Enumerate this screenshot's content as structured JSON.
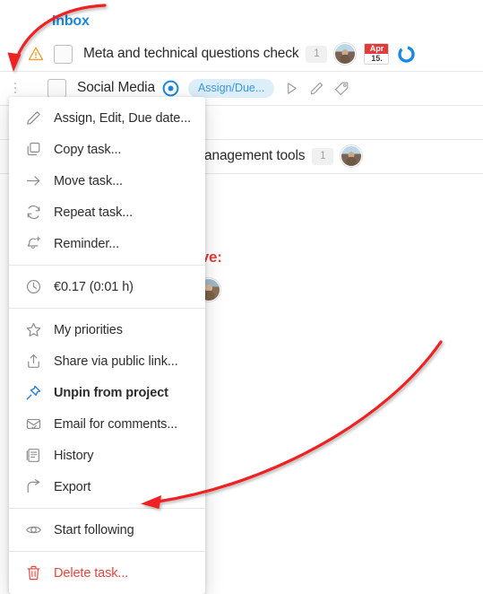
{
  "colors": {
    "accent_blue": "#1a87e0",
    "pill_bg": "#ddeefb",
    "pill_text": "#3a95df",
    "danger_red": "#e8453c",
    "heading_red": "#e23b3b",
    "warning_orange": "#f0a030",
    "annotation_red": "#ee2222",
    "pin_blue": "#2a7fd4"
  },
  "list": {
    "header": "Inbox",
    "rows": [
      {
        "name": "Meta and technical questions check",
        "warning_icon": "warning-triangle-icon",
        "count": "1",
        "avatar": "user-avatar",
        "date_month": "Apr",
        "date_day": "15.",
        "progress_ring": "progress-ring-icon"
      },
      {
        "name": "Social Media",
        "handle": "drag-handle-icon",
        "radio": "radio-dot-icon",
        "pill": "Assign/Due...",
        "icons": [
          "play-icon",
          "pencil-icon",
          "tag-icon"
        ]
      },
      {
        "name": "anagement tools",
        "count": "1",
        "avatar": "user-avatar"
      }
    ],
    "red_heading": "list have:"
  },
  "menu": {
    "groups": [
      {
        "items": [
          {
            "label": "Assign, Edit, Due date...",
            "icon": "pencil-icon",
            "style": "normal"
          },
          {
            "label": "Copy task...",
            "icon": "copy-icon",
            "style": "normal"
          },
          {
            "label": "Move task...",
            "icon": "arrow-right-icon",
            "style": "normal"
          },
          {
            "label": "Repeat task...",
            "icon": "repeat-icon",
            "style": "normal"
          },
          {
            "label": "Reminder...",
            "icon": "bell-plus-icon",
            "style": "normal"
          }
        ]
      },
      {
        "items": [
          {
            "label": "€0.17 (0:01 h)",
            "icon": "clock-icon",
            "style": "normal"
          }
        ]
      },
      {
        "items": [
          {
            "label": "My priorities",
            "icon": "star-icon",
            "style": "normal"
          },
          {
            "label": "Share via public link...",
            "icon": "share-upload-icon",
            "style": "normal"
          },
          {
            "label": "Unpin from project",
            "icon": "pin-icon",
            "style": "bold"
          },
          {
            "label": "Email for comments...",
            "icon": "envelope-check-icon",
            "style": "normal"
          },
          {
            "label": "History",
            "icon": "history-document-icon",
            "style": "normal"
          },
          {
            "label": "Export",
            "icon": "export-arrow-icon",
            "style": "normal"
          }
        ]
      },
      {
        "items": [
          {
            "label": "Start following",
            "icon": "eye-icon",
            "style": "normal"
          }
        ]
      },
      {
        "items": [
          {
            "label": "Delete task...",
            "icon": "trash-icon",
            "style": "danger"
          }
        ]
      }
    ]
  },
  "annotations": [
    {
      "name": "arrow-to-row-handle",
      "target": "drag-handle-icon"
    },
    {
      "name": "arrow-to-start-following",
      "target": "Start following"
    }
  ]
}
